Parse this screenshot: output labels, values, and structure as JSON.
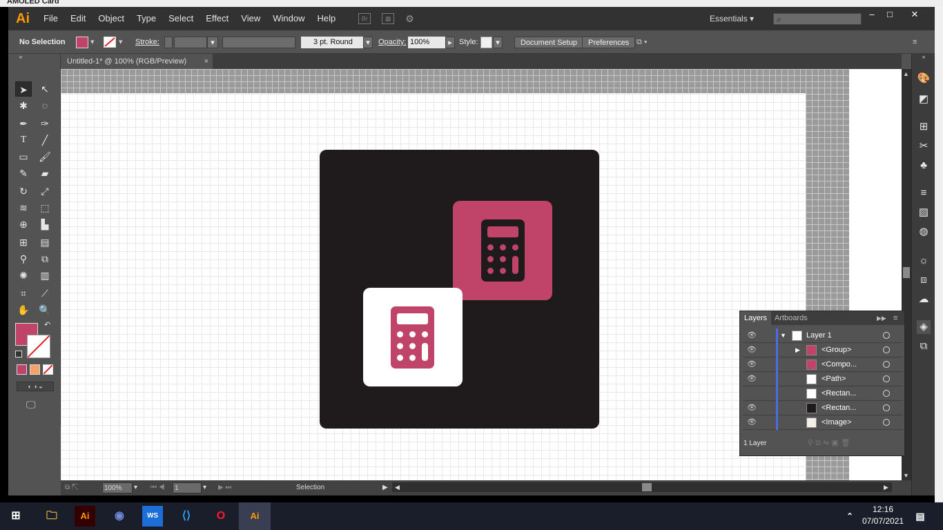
{
  "background_window": {
    "title": "AMOLED Card"
  },
  "menubar": {
    "logo": "Ai",
    "items": [
      "File",
      "Edit",
      "Object",
      "Type",
      "Select",
      "Effect",
      "View",
      "Window",
      "Help"
    ],
    "bridge_label": "Br",
    "workspace": "Essentials",
    "search_placeholder": ""
  },
  "controlbar": {
    "selection": "No Selection",
    "stroke_label": "Stroke:",
    "brush": "3 pt. Round",
    "opacity_label": "Opacity:",
    "opacity_value": "100%",
    "style_label": "Style:",
    "document_setup": "Document Setup",
    "preferences": "Preferences",
    "fill_color": "#c0446a"
  },
  "document_tab": {
    "title": "Untitled-1* @ 100% (RGB/Preview)",
    "close": "×"
  },
  "artwork": {
    "background_color": "#1f1b1d",
    "accent_color": "#c0446a",
    "white_color": "#ffffff"
  },
  "statusbar": {
    "zoom": "100%",
    "artboard": "1",
    "tool": "Selection"
  },
  "layers_panel": {
    "tabs": [
      "Layers",
      "Artboards"
    ],
    "rows": [
      {
        "name": "Layer 1",
        "visible": true
      },
      {
        "name": "<Group>",
        "visible": true
      },
      {
        "name": "<Compo...",
        "visible": true
      },
      {
        "name": "<Path>",
        "visible": true
      },
      {
        "name": "<Rectan...",
        "visible": false
      },
      {
        "name": "<Rectan...",
        "visible": true
      },
      {
        "name": "<Image>",
        "visible": true
      }
    ],
    "footer": "1 Layer"
  },
  "taskbar": {
    "time": "12:16",
    "date": "07/07/2021",
    "apps": [
      "windows-start",
      "file-explorer",
      "illustrator",
      "discord",
      "webstorm",
      "vscode",
      "opera",
      "illustrator-active"
    ]
  }
}
